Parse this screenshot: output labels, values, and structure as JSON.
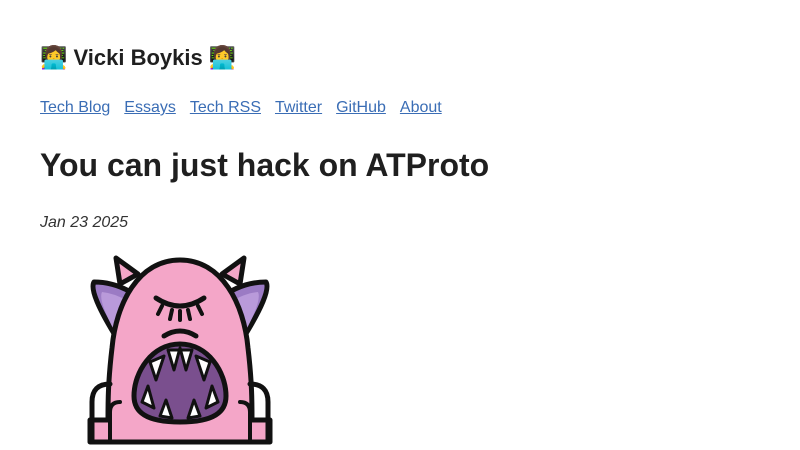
{
  "site": {
    "title": "👩‍💻 Vicki Boykis 👩‍💻"
  },
  "nav": [
    {
      "label": "Tech Blog"
    },
    {
      "label": "Essays"
    },
    {
      "label": "Tech RSS"
    },
    {
      "label": "Twitter"
    },
    {
      "label": "GitHub"
    },
    {
      "label": "About"
    }
  ],
  "post": {
    "title": "You can just hack on ATProto",
    "date": "Jan 23 2025"
  },
  "colors": {
    "link": "#3a6db5",
    "monster_body": "#f4a6c8",
    "monster_ears": "#9b7bc4",
    "monster_mouth": "#7a4f8e"
  }
}
